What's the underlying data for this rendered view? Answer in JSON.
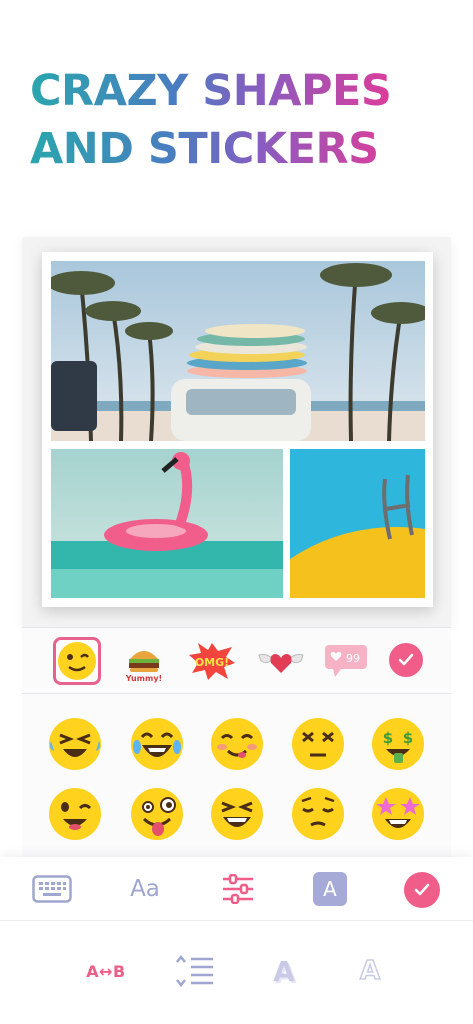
{
  "headline": {
    "line1": "CRAZY SHAPES",
    "line2": "AND STICKERS"
  },
  "colors": {
    "accent": "#ef5d88",
    "tool_inactive": "#9fa6cf",
    "emoji_yellow": "#ffd21e"
  },
  "collage": {
    "photos": [
      {
        "subject": "beach-van-surfboards"
      },
      {
        "subject": "pink-flamingo-float"
      },
      {
        "subject": "pool-ladder-yellow"
      }
    ]
  },
  "sticker_tabs": [
    {
      "icon": "wink-emoji-icon",
      "selected": true
    },
    {
      "icon": "burger-yummy-sticker",
      "text": "Yummy!"
    },
    {
      "icon": "omg-comic-sticker",
      "text": "OMG!"
    },
    {
      "icon": "winged-heart-sticker"
    },
    {
      "icon": "like-counter-sticker",
      "text": "99"
    }
  ],
  "emojis": [
    "crying-laughing-emoji",
    "tears-of-joy-emoji",
    "yum-emoji",
    "dizzy-x-eyes-emoji",
    "money-mouth-emoji",
    "winking-emoji",
    "zany-tongue-emoji",
    "grinning-squint-emoji",
    "pensive-emoji",
    "star-struck-emoji"
  ],
  "toolbar": {
    "text_tool_label": "Aa",
    "color_tool_label": "A"
  },
  "subtools": {
    "letter_spacing_label": "A↔B",
    "font_a_label": "A",
    "outline_a_label": "A"
  }
}
